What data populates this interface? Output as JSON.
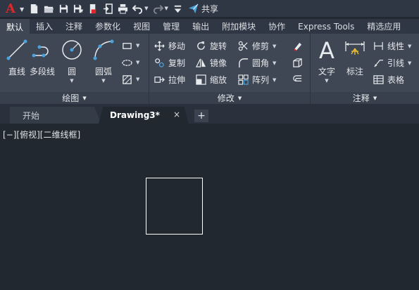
{
  "quick_access": {
    "logo": "A",
    "share_label": "共享",
    "icons": [
      "new-file-icon",
      "open-folder-icon",
      "save-icon",
      "save-as-icon",
      "web-mobile-icon",
      "import-icon",
      "print-icon",
      "undo-icon",
      "redo-icon",
      "customize-icon",
      "share-icon"
    ]
  },
  "ribbon_tabs": [
    "默认",
    "插入",
    "注释",
    "参数化",
    "视图",
    "管理",
    "输出",
    "附加模块",
    "协作",
    "Express Tools",
    "精选应用"
  ],
  "active_tab": "默认",
  "panels": {
    "draw": {
      "title": "绘图",
      "tools": {
        "line": "直线",
        "polyline": "多段线",
        "circle": "圆",
        "arc": "圆弧"
      }
    },
    "modify": {
      "title": "修改",
      "tools": {
        "move": "移动",
        "rotate": "旋转",
        "trim": "修剪",
        "copy": "复制",
        "mirror": "镜像",
        "fillet": "圆角",
        "stretch": "拉伸",
        "scale": "缩放",
        "array": "阵列"
      }
    },
    "annotation": {
      "title": "注释",
      "tools": {
        "text": "文字",
        "dimension": "标注",
        "linear": "线性",
        "leader": "引线",
        "table": "表格"
      }
    }
  },
  "file_tabs": {
    "start": "开始",
    "document": "Drawing3*",
    "close": "×",
    "new": "+"
  },
  "viewport": {
    "label": "[−][俯视][二维线框]"
  },
  "colors": {
    "logo_red": "#e0262b",
    "accent_blue": "#4aa3df",
    "canvas_bg": "#212830",
    "ribbon_bg": "#3f4755"
  }
}
